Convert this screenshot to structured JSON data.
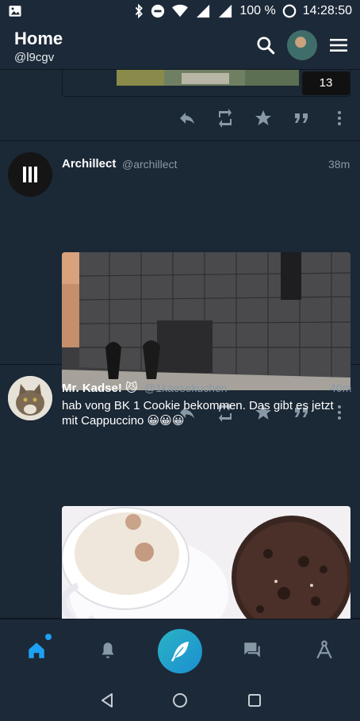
{
  "status_bar": {
    "battery": "100 %",
    "time": "14:28:50"
  },
  "app_bar": {
    "title": "Home",
    "handle": "@l9cgv"
  },
  "feed": {
    "partial_tweet": {
      "media_count": "13"
    },
    "tweets": [
      {
        "name": "Archillect",
        "username": "@archillect",
        "time": "38m",
        "avatar_icon": "pause-bars-icon",
        "media_description_icon": "building-photo"
      },
      {
        "name": "Mr. Kadse! 😼",
        "username": "@1kaesekuchen",
        "time": "40m",
        "text": "hab vong BK 1 Cookie bekommen. Das gibt es jetzt mit Cappuccino 😀😀😀",
        "avatar_icon": "cat-avatar",
        "media_description_icon": "cappuccino-cookie-photo"
      }
    ]
  },
  "colors": {
    "background": "#1b2836",
    "appbar": "#1c2938",
    "muted": "#8899a6",
    "accent": "#1da1f2"
  }
}
